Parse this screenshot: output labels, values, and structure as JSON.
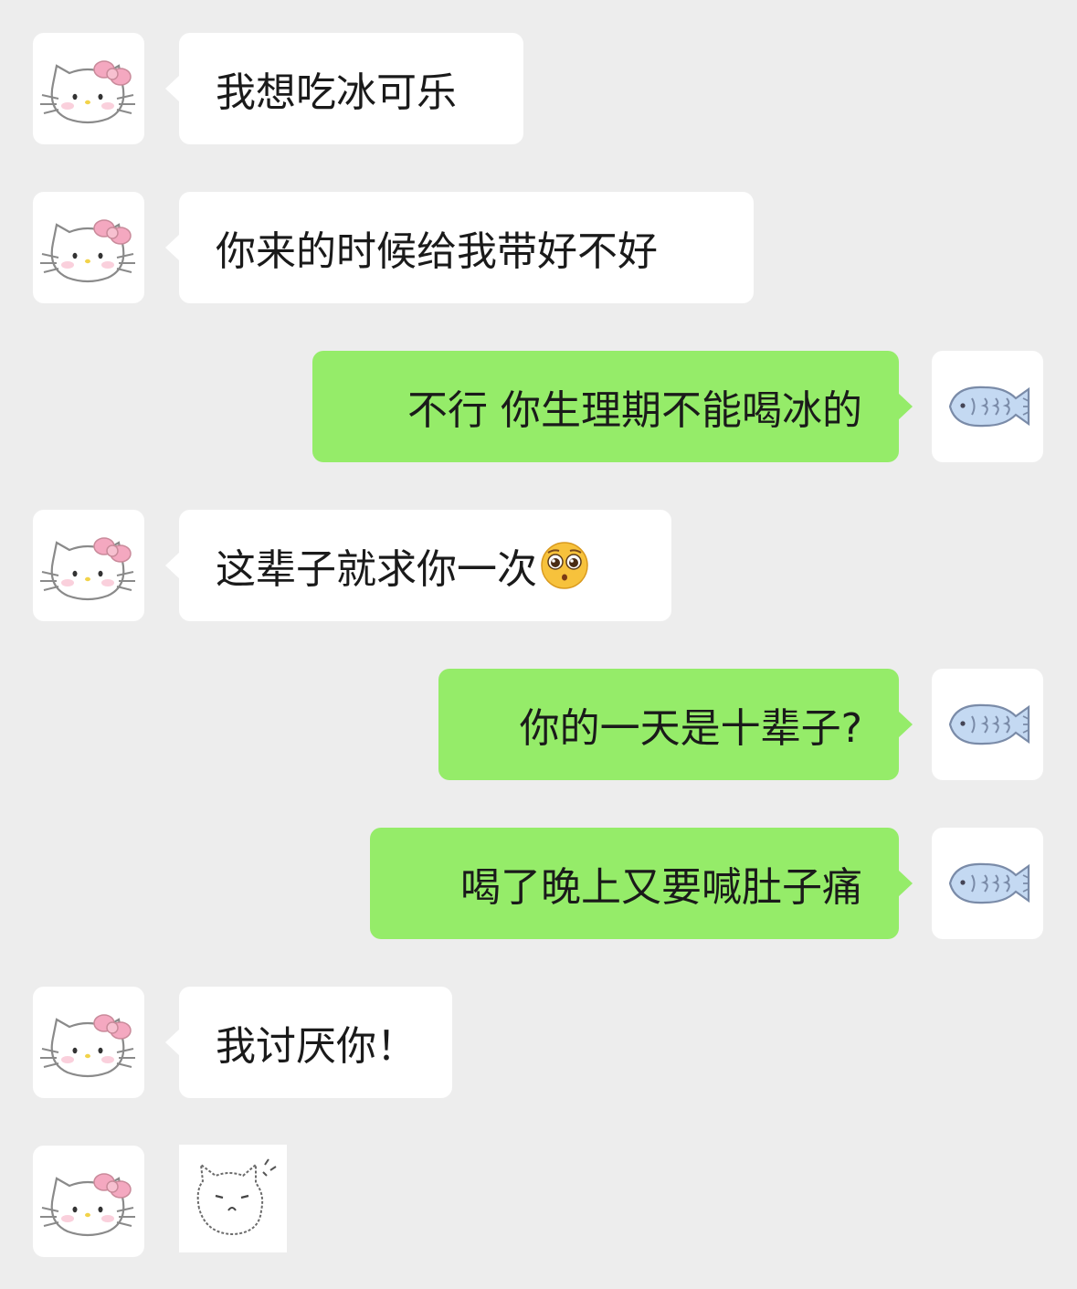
{
  "chat": {
    "messages": [
      {
        "side": "left",
        "type": "text",
        "text": "我想吃冰可乐"
      },
      {
        "side": "left",
        "type": "text",
        "text": "你来的时候给我带好不好"
      },
      {
        "side": "right",
        "type": "text",
        "text": "不行 你生理期不能喝冰的"
      },
      {
        "side": "left",
        "type": "text",
        "text": "这辈子就求你一次",
        "emoji": "pleading-face-icon"
      },
      {
        "side": "right",
        "type": "text",
        "text": "你的一天是十辈子?"
      },
      {
        "side": "right",
        "type": "text",
        "text": "喝了晚上又要喊肚子痛"
      },
      {
        "side": "left",
        "type": "text",
        "text": "我讨厌你！"
      },
      {
        "side": "left",
        "type": "sticker",
        "sticker": "angry-cat-sticker-icon"
      }
    ],
    "avatars": {
      "left": "hello-kitty-avatar-icon",
      "right": "blue-fish-avatar-icon"
    }
  },
  "colors": {
    "background": "#ededed",
    "incoming_bubble": "#ffffff",
    "outgoing_bubble": "#95ec69",
    "kitty_bow": "#f4a8c0",
    "fish_body": "#c4d9f2"
  }
}
